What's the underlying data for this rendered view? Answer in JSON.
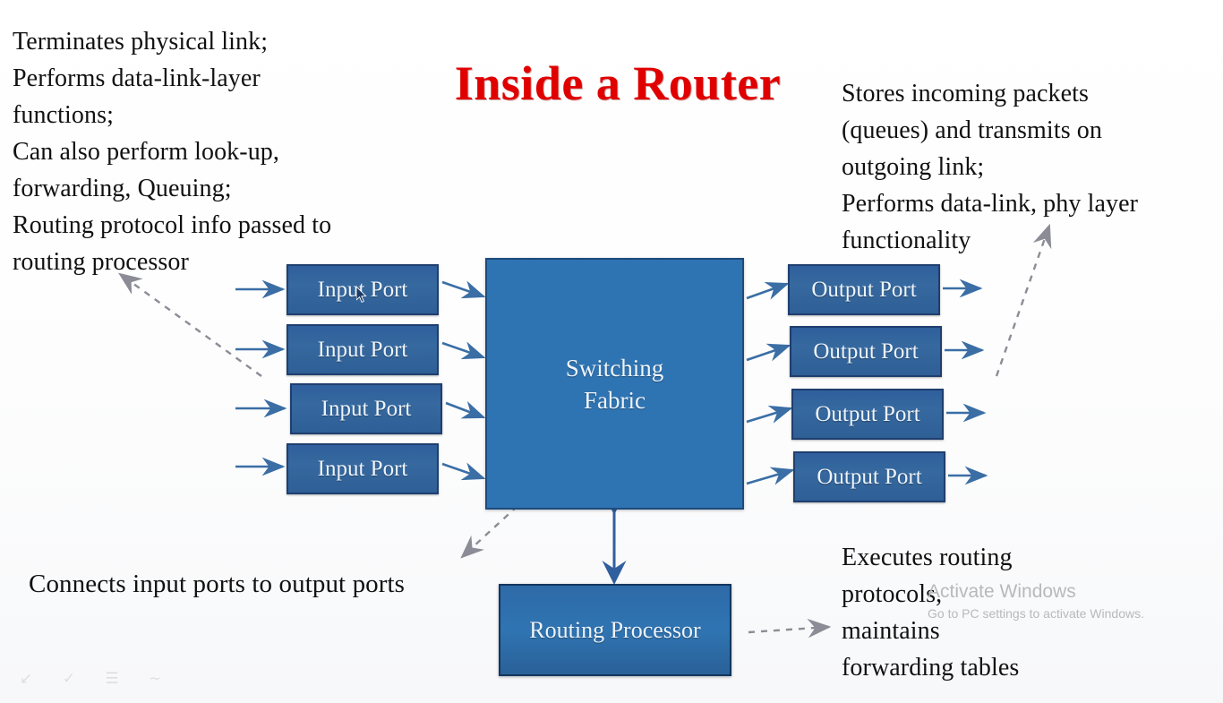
{
  "title": "Inside a Router",
  "notes": {
    "input_port_note": "Terminates physical link;\nPerforms data-link-layer\nfunctions;\nCan also perform look-up,\nforwarding, Queuing;\nRouting protocol info passed to\nrouting processor",
    "output_port_note": "Stores incoming packets\n(queues) and transmits on\noutgoing link;\nPerforms data-link, phy layer\nfunctionality",
    "switching_fabric_note": "Connects input ports to output ports",
    "routing_processor_note": "Executes routing\nprotocols,\nmaintains\nforwarding tables"
  },
  "diagram": {
    "input_ports": [
      {
        "label": "Input Port"
      },
      {
        "label": "Input Port"
      },
      {
        "label": "Input Port"
      },
      {
        "label": "Input Port"
      }
    ],
    "switching_fabric": {
      "label_line1": "Switching",
      "label_line2": "Fabric"
    },
    "output_ports": [
      {
        "label": "Output Port"
      },
      {
        "label": "Output Port"
      },
      {
        "label": "Output Port"
      },
      {
        "label": "Output Port"
      }
    ],
    "routing_processor": {
      "label": "Routing Processor"
    }
  },
  "watermark": {
    "title": "Activate Windows",
    "subtitle": "Go to PC settings to activate Windows."
  },
  "toolbar": {
    "icons": [
      "undo-icon",
      "pen-icon",
      "list-icon",
      "shape-icon"
    ]
  },
  "colors": {
    "title_red": "#e00000",
    "port_blue": "#2f5f9d",
    "fabric_blue": "#2f74b2",
    "border_blue": "#1f3f6e",
    "arrow_blue": "#3a6ea5",
    "dashed_gray": "#8c8c96",
    "watermark_gray": "#b9b9b9"
  }
}
